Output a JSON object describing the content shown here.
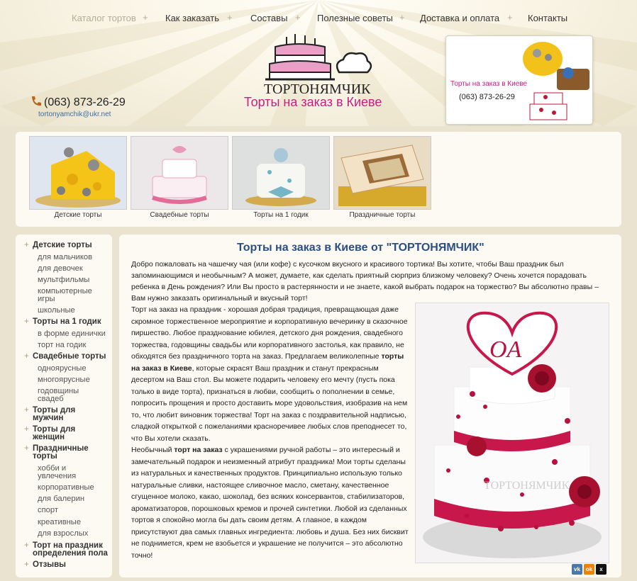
{
  "nav": {
    "items": [
      "Каталог тортов",
      "Как заказать",
      "Составы",
      "Полезные советы",
      "Доставка и оплата",
      "Контакты"
    ],
    "separator": "+"
  },
  "header": {
    "logo_text": "ТОРТОНЯМЧИК",
    "slogan": "Торты на заказ в Киеве",
    "phone": "(063) 873-26-29",
    "email": "tortonyamchik@ukr.net",
    "promo_title": "Торты на заказ в Киеве",
    "promo_phone": "(063) 873-26-29"
  },
  "categories": [
    {
      "label": "Детские торты",
      "icon": "cheese-cake-image"
    },
    {
      "label": "Свадебные торты",
      "icon": "wedding-cake-image"
    },
    {
      "label": "Торты на 1 годик",
      "icon": "bow-cake-image"
    },
    {
      "label": "Праздничные торты",
      "icon": "book-cake-image"
    }
  ],
  "sidebar": {
    "plus": "+",
    "items": [
      {
        "label": "Детские торты",
        "level": 0
      },
      {
        "label": "для мальчиков",
        "level": 1
      },
      {
        "label": "для девочек",
        "level": 1
      },
      {
        "label": "мультфильмы",
        "level": 1
      },
      {
        "label": "компьютерные игры",
        "level": 1
      },
      {
        "label": "школьные",
        "level": 1
      },
      {
        "label": "Торты на 1 годик",
        "level": 0
      },
      {
        "label": "в форме единички",
        "level": 1
      },
      {
        "label": "торт на годик",
        "level": 1
      },
      {
        "label": "Свадебные торты",
        "level": 0
      },
      {
        "label": "одноярусные",
        "level": 1
      },
      {
        "label": "многоярусные",
        "level": 1
      },
      {
        "label": "годовщины свадеб",
        "level": 1
      },
      {
        "label": "Торты для мужчин",
        "level": 0
      },
      {
        "label": "Торты для женщин",
        "level": 0
      },
      {
        "label": "Праздничные торты",
        "level": 0
      },
      {
        "label": "хобби и увлечения",
        "level": 1
      },
      {
        "label": "корпоративные",
        "level": 1
      },
      {
        "label": "для балерин",
        "level": 1
      },
      {
        "label": "спорт",
        "level": 1
      },
      {
        "label": "креативные",
        "level": 1
      },
      {
        "label": "для взрослых",
        "level": 1
      },
      {
        "label": "Торт на праздник определения пола",
        "level": 0
      },
      {
        "label": "Отзывы",
        "level": 0
      }
    ]
  },
  "main": {
    "title": "Торты на заказ в Киеве от \"ТОРТОНЯМЧИК\"",
    "intro": "Добро пожаловать на чашечку чая (или кофе) с кусочком вкусного и красивого тортика! Вы хотите, чтобы Ваш праздник был запоминающимся и необычным? А может, думаете, как сделать приятный сюрприз близкому человеку? Очень хочется порадовать ребенка в День рождения? Или Вы просто в растерянности и не знаете, какой выбрать подарок на торжество? Вы абсолютно правы – Вам нужно заказать оригинальный и вкусный торт!",
    "p1_before": "Торт на заказ на праздник - хорошая добрая традиция, превращающая даже скромное торжественное мероприятие и корпоративную вечеринку в сказочное пиршество. Любое празднование юбилея, детского дня рождения, свадебного торжества, годовщины свадьбы или корпоративного застолья, как правило, не обходятся без праздничного торта на заказ. Предлагаем великолепные ",
    "p1_bold": "торты на заказ в Киеве",
    "p1_after": ", которые скрасят Ваш праздник и станут прекрасным десертом на Ваш стол. Вы можете подарить человеку его мечту (пусть пока только в виде торта), признаться в любви, сообщить о пополнении в семье, попросить прощения и просто доставить море удовольствия, изобразив на нем то, что любит виновник торжества! Торт на заказ с поздравительной надписью, сладкой открыткой с пожеланиями красноречивее любых слов преподнесет то, что Вы хотели сказать.",
    "p2_before": "Необычный ",
    "p2_bold": "торт на заказ",
    "p2_after": " с украшениями ручной работы – это интересный и замечательный подарок и неизменный атрибут праздника! Мои торты сделаны из натуральных и качественных продуктов. Принципиально использую только натуральные сливки, настоящее сливочное масло, сметану, качественное сгущенное молоко, какао, шоколад, без всяких консервантов, стабилизаторов, ароматизаторов, порошковых кремов и прочей синтетики. Любой из сделанных тортов я спокойно могла бы дать своим детям. А главное, в каждом присутствуют два самых главных ингредиента: любовь и душа. Без них бисквит не поднимется, крем не взобьется и украшение не получится – это абсолютно точно!",
    "photo_initials": "OA"
  },
  "share": {
    "labels": [
      "vk",
      "ok",
      "x"
    ],
    "colors": [
      "#4a76a8",
      "#ee8208",
      "#111111"
    ]
  },
  "colors": {
    "accent_pink": "#c61f82",
    "title_blue": "#2b4f82",
    "link_blue": "#3a6fa8"
  }
}
